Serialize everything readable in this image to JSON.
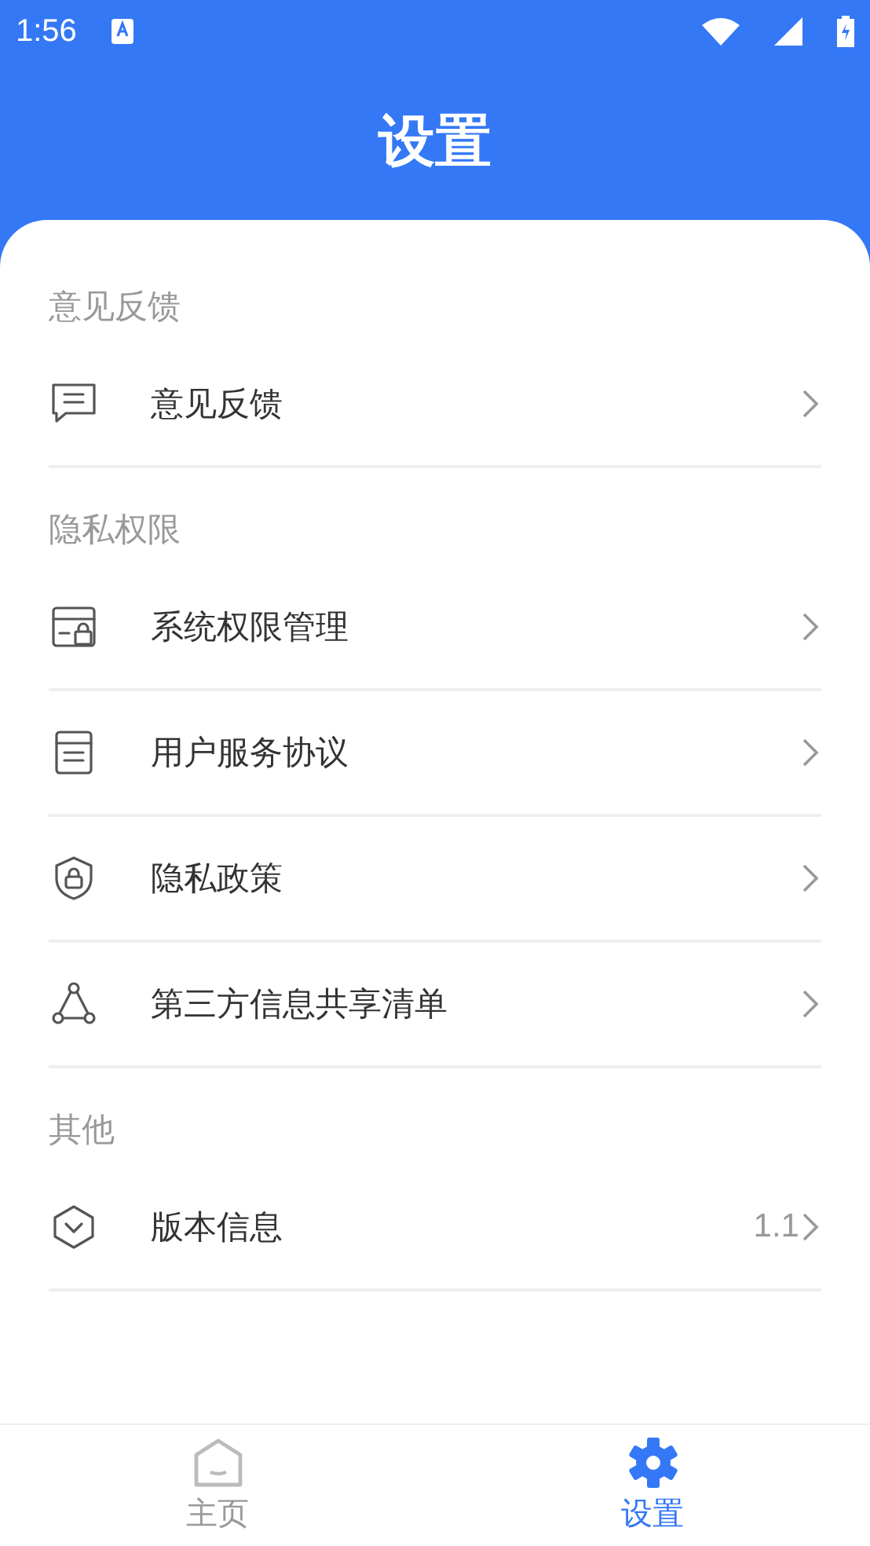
{
  "status_bar": {
    "time": "1:56"
  },
  "header": {
    "title": "设置"
  },
  "sections": [
    {
      "title": "意见反馈",
      "items": [
        {
          "label": "意见反馈"
        }
      ]
    },
    {
      "title": "隐私权限",
      "items": [
        {
          "label": "系统权限管理"
        },
        {
          "label": "用户服务协议"
        },
        {
          "label": "隐私政策"
        },
        {
          "label": "第三方信息共享清单"
        }
      ]
    },
    {
      "title": "其他",
      "items": [
        {
          "label": "版本信息",
          "value": "1.1"
        }
      ]
    }
  ],
  "tabs": [
    {
      "label": "主页",
      "selected": false
    },
    {
      "label": "设置",
      "selected": true
    }
  ]
}
